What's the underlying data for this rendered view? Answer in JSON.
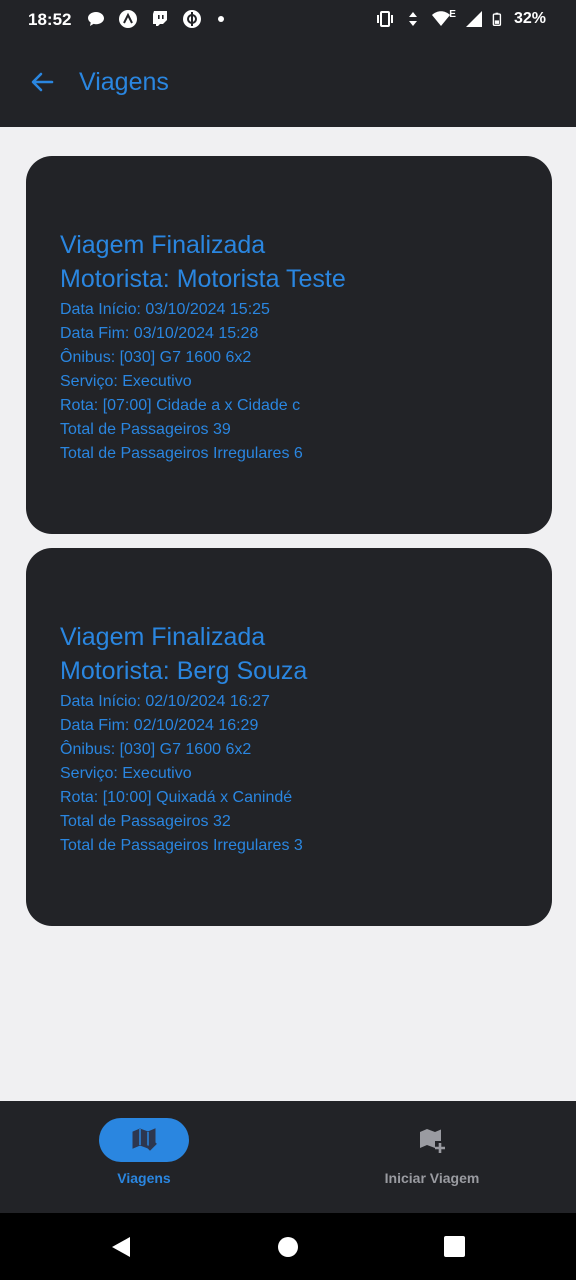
{
  "status_bar": {
    "time": "18:52",
    "battery": "32%",
    "network_letter": "E"
  },
  "app_bar": {
    "title": "Viagens"
  },
  "trips": [
    {
      "status": "Viagem Finalizada",
      "driver": "Motorista: Motorista Teste",
      "start": "Data Início: 03/10/2024 15:25",
      "end": "Data Fim: 03/10/2024 15:28",
      "bus": "Ônibus: [030] G7 1600 6x2",
      "service": "Serviço: Executivo",
      "route": "Rota: [07:00] Cidade a x Cidade c",
      "passengers": "Total de Passageiros 39",
      "irregular": "Total de Passageiros Irregulares 6"
    },
    {
      "status": "Viagem Finalizada",
      "driver": "Motorista: Berg Souza",
      "start": "Data Início: 02/10/2024 16:27",
      "end": "Data Fim: 02/10/2024 16:29",
      "bus": "Ônibus: [030] G7 1600 6x2",
      "service": "Serviço: Executivo",
      "route": "Rota: [10:00] Quixadá  x Canindé",
      "passengers": "Total de Passageiros 32",
      "irregular": "Total de Passageiros Irregulares 3"
    }
  ],
  "bottom_nav": {
    "items": [
      {
        "label": "Viagens",
        "icon": "map-check-icon",
        "active": true
      },
      {
        "label": "Iniciar Viagem",
        "icon": "map-plus-icon",
        "active": false
      }
    ]
  },
  "colors": {
    "accent": "#2a86e0",
    "surface": "#222327",
    "background": "#f0f0f2"
  }
}
